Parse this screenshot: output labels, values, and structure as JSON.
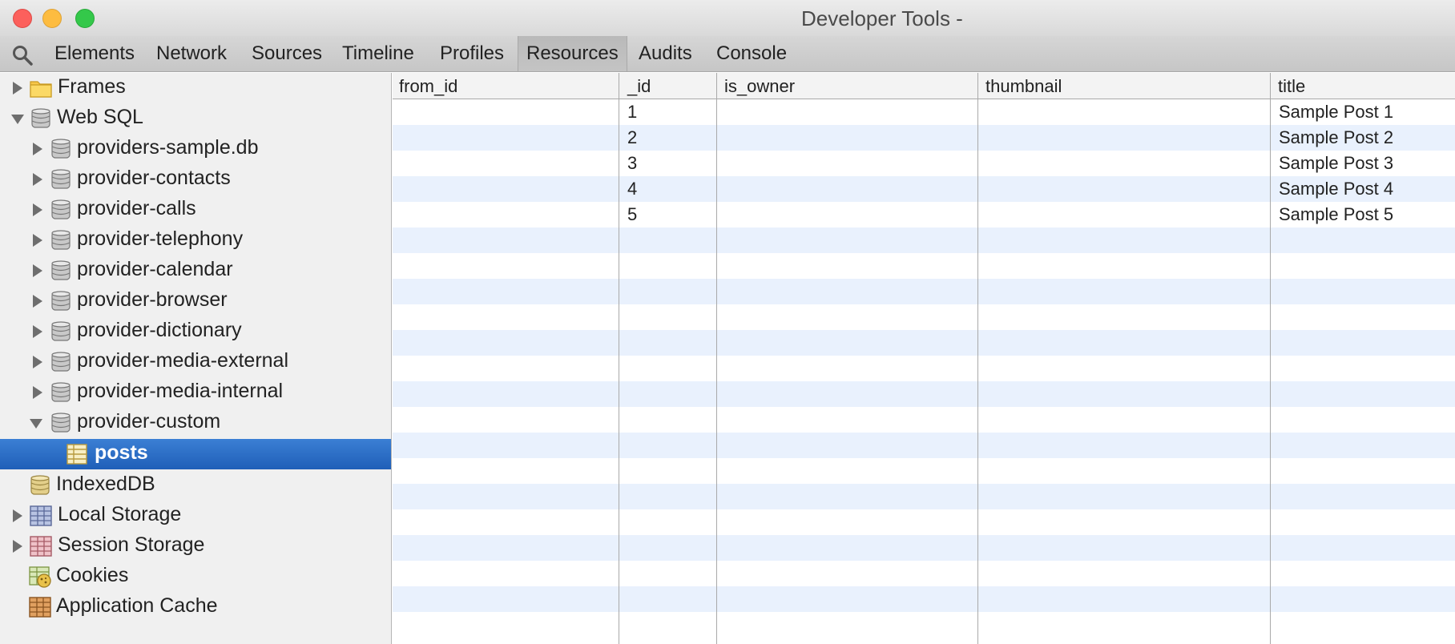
{
  "window": {
    "title": "Developer Tools -"
  },
  "toolbar": {
    "tabs": [
      {
        "label": "Elements"
      },
      {
        "label": "Network"
      },
      {
        "label": "Sources"
      },
      {
        "label": "Timeline"
      },
      {
        "label": "Profiles"
      },
      {
        "label": "Resources",
        "selected": true
      },
      {
        "label": "Audits"
      },
      {
        "label": "Console"
      }
    ]
  },
  "sidebar": {
    "items": [
      {
        "label": "Frames",
        "icon": "folder-icon",
        "disclosure": "collapsed"
      },
      {
        "label": "Web SQL",
        "icon": "database-icon",
        "disclosure": "expanded"
      },
      {
        "label": "providers-sample.db",
        "icon": "database-icon",
        "disclosure": "collapsed"
      },
      {
        "label": "provider-contacts",
        "icon": "database-icon",
        "disclosure": "collapsed"
      },
      {
        "label": "provider-calls",
        "icon": "database-icon",
        "disclosure": "collapsed"
      },
      {
        "label": "provider-telephony",
        "icon": "database-icon",
        "disclosure": "collapsed"
      },
      {
        "label": "provider-calendar",
        "icon": "database-icon",
        "disclosure": "collapsed"
      },
      {
        "label": "provider-browser",
        "icon": "database-icon",
        "disclosure": "collapsed"
      },
      {
        "label": "provider-dictionary",
        "icon": "database-icon",
        "disclosure": "collapsed"
      },
      {
        "label": "provider-media-external",
        "icon": "database-icon",
        "disclosure": "collapsed"
      },
      {
        "label": "provider-media-internal",
        "icon": "database-icon",
        "disclosure": "collapsed"
      },
      {
        "label": "provider-custom",
        "icon": "database-icon",
        "disclosure": "expanded"
      },
      {
        "label": "posts",
        "icon": "table-icon",
        "disclosure": "none",
        "selected": true
      },
      {
        "label": "IndexedDB",
        "icon": "database-icon",
        "disclosure": "none"
      },
      {
        "label": "Local Storage",
        "icon": "local-storage-icon",
        "disclosure": "collapsed"
      },
      {
        "label": "Session Storage",
        "icon": "session-storage-icon",
        "disclosure": "collapsed"
      },
      {
        "label": "Cookies",
        "icon": "cookies-icon",
        "disclosure": "none"
      },
      {
        "label": "Application Cache",
        "icon": "application-cache-icon",
        "disclosure": "none"
      }
    ]
  },
  "grid": {
    "columns": [
      "from_id",
      "_id",
      "is_owner",
      "thumbnail",
      "title"
    ],
    "rows": [
      [
        "",
        "1",
        "",
        "",
        "Sample Post 1"
      ],
      [
        "",
        "2",
        "",
        "",
        "Sample Post 2"
      ],
      [
        "",
        "3",
        "",
        "",
        "Sample Post 3"
      ],
      [
        "",
        "4",
        "",
        "",
        "Sample Post 4"
      ],
      [
        "",
        "5",
        "",
        "",
        "Sample Post 5"
      ]
    ]
  },
  "colors": {
    "selection": "#2a6cc8",
    "stripe": "#e9f1fd",
    "sidebar_bg": "#f0f0f0"
  }
}
